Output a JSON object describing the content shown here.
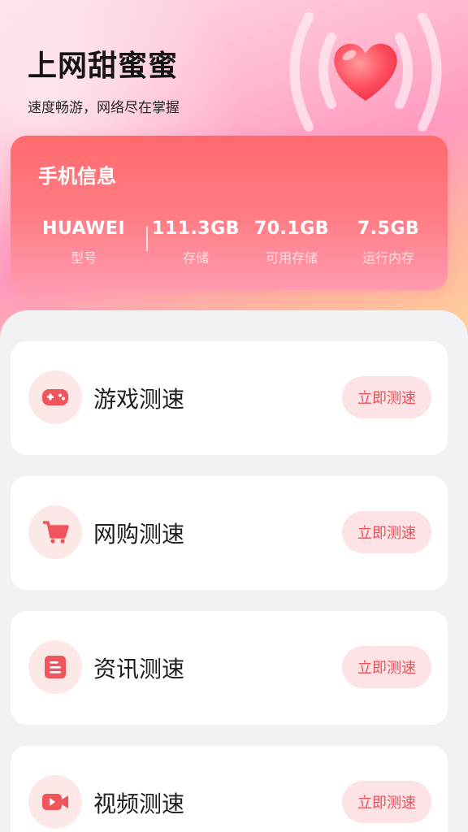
{
  "header": {
    "title": "上网甜蜜蜜",
    "subtitle": "速度畅游，网络尽在掌握"
  },
  "phone_info": {
    "title": "手机信息",
    "stats": [
      {
        "value": "HUAWEI",
        "label": "型号"
      },
      {
        "value": "111.3GB",
        "label": "存储"
      },
      {
        "value": "70.1GB",
        "label": "可用存储"
      },
      {
        "value": "7.5GB",
        "label": "运行内存"
      }
    ]
  },
  "tests": [
    {
      "label": "游戏测速",
      "button": "立即测速",
      "icon": "gamepad-icon"
    },
    {
      "label": "网购测速",
      "button": "立即测速",
      "icon": "shopping-cart-icon"
    },
    {
      "label": "资讯测速",
      "button": "立即测速",
      "icon": "news-icon"
    },
    {
      "label": "视频测速",
      "button": "立即测速",
      "icon": "video-icon"
    }
  ],
  "colors": {
    "accent": "#ff6a6e",
    "icon": "#f0555c",
    "button_bg": "#fde3e6",
    "button_text": "#e8525a"
  }
}
